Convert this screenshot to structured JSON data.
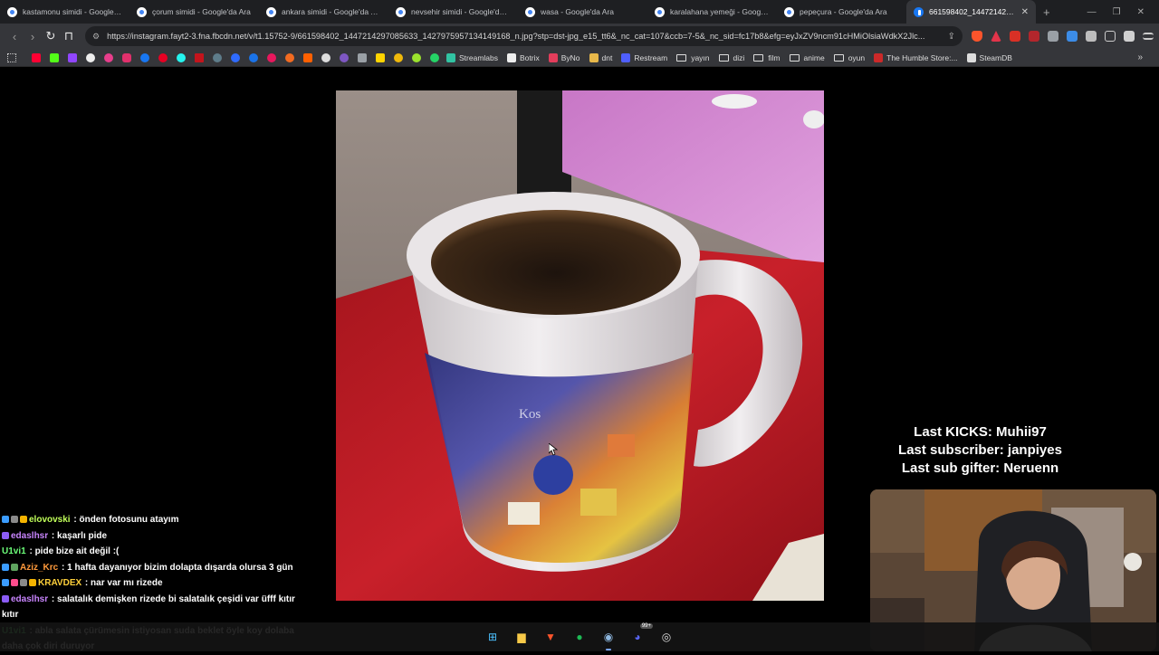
{
  "browser": {
    "tabs": [
      {
        "title": "kastamonu simidi - Google'da Ara",
        "active": false
      },
      {
        "title": "çorum simidi - Google'da Ara",
        "active": false
      },
      {
        "title": "ankara simidi - Google'da Ara",
        "active": false
      },
      {
        "title": "nevsehir simidi - Google'da Ara",
        "active": false
      },
      {
        "title": "wasa - Google'da Ara",
        "active": false
      },
      {
        "title": "karalahana yemeği - Google'da Ara",
        "active": false
      },
      {
        "title": "pepeçura - Google'da Ara",
        "active": false
      },
      {
        "title": "661598402_1447214297085...",
        "active": true
      }
    ],
    "new_tab_label": "+",
    "window_controls": {
      "minimize": "—",
      "restore": "❐",
      "close": "✕"
    },
    "url": "https://instagram.fayt2-3.fna.fbcdn.net/v/t1.15752-9/661598402_1447214297085633_1427975957134149168_n.jpg?stp=dst-jpg_e15_tt6&_nc_cat=107&ccb=7-5&_nc_sid=fc17b8&efg=eyJxZV9ncm91cHMiOlsiaWdkX2Jlc...",
    "bookmarks": [
      {
        "label": "Streamlabs",
        "color": "#31c3a2",
        "kind": "site"
      },
      {
        "label": "Botrix",
        "color": "#eeeeee",
        "kind": "site"
      },
      {
        "label": "ByNo",
        "color": "#e33d5b",
        "kind": "site"
      },
      {
        "label": "dnt",
        "color": "#e8b84a",
        "kind": "site"
      },
      {
        "label": "Restream",
        "color": "#4f5fff",
        "kind": "site"
      },
      {
        "label": "yayın",
        "kind": "folder"
      },
      {
        "label": "dizi",
        "kind": "folder"
      },
      {
        "label": "film",
        "kind": "folder"
      },
      {
        "label": "anime",
        "kind": "folder"
      },
      {
        "label": "oyun",
        "kind": "folder"
      },
      {
        "label": "The Humble Store:...",
        "color": "#cc2929",
        "kind": "site"
      },
      {
        "label": "SteamDB",
        "color": "#dddddd",
        "kind": "site"
      }
    ],
    "bookmark_more": "»"
  },
  "overlay": {
    "last_kicks": "Last KICKS: Muhii97",
    "last_subscriber": "Last subscriber: janpiyes",
    "last_sub_gifter": "Last sub gifter: Neruenn"
  },
  "photo": {
    "mug_text": "Kos"
  },
  "chat": [
    {
      "user": "elovovski",
      "color": "#c1ff5a",
      "message": " : önden fotosunu atayım",
      "badges": [
        "#3b9cff",
        "#8a8a8a",
        "#f5b400"
      ]
    },
    {
      "user": "edaslhsr",
      "color": "#c985ff",
      "message": " : kaşarlı pide",
      "badges": [
        "#8b5cf6"
      ]
    },
    {
      "user": "U1vi1",
      "color": "#6dff7a",
      "message": " : pide bize ait değil :(",
      "badges": []
    },
    {
      "user": "Aziz_Krc",
      "color": "#ff9a3c",
      "message": " : 1 hafta dayanıyor bizim dolapta dışarda olursa 3 gün",
      "badges": [
        "#3b9cff",
        "#5fa35f"
      ]
    },
    {
      "user": "KRAVDEX",
      "color": "#ffd13b",
      "message": " : nar var mı rizede",
      "badges": [
        "#3b9cff",
        "#ff4d8d",
        "#8a8a8a",
        "#f5b400"
      ]
    },
    {
      "user": "edaslhsr",
      "color": "#c985ff",
      "message": " : salatalık demişken rizede bi salatalık çeşidi var üfff kıtır kıtır",
      "badges": [
        "#8b5cf6"
      ]
    },
    {
      "user": "U1vi1",
      "color": "#6dff7a",
      "message": " : abla salata çürümesin istiyosan suda beklet öyle koy dolaba daha çok diri duruyor",
      "badges": []
    }
  ],
  "taskbar": {
    "items": [
      {
        "name": "windows-start-icon",
        "glyph": "⊞",
        "color": "#4cc2ff"
      },
      {
        "name": "file-explorer-icon",
        "glyph": "▆",
        "color": "#f7c948"
      },
      {
        "name": "brave-browser-icon",
        "glyph": "▼",
        "color": "#fb542b"
      },
      {
        "name": "spotify-icon",
        "glyph": "●",
        "color": "#1db954"
      },
      {
        "name": "steam-icon",
        "glyph": "◉",
        "color": "#8fb8e0"
      },
      {
        "name": "discord-icon",
        "glyph": "◕",
        "color": "#5865f2"
      },
      {
        "name": "obs-icon",
        "glyph": "◎",
        "color": "#dddddd"
      }
    ],
    "discord_badge": "99+"
  }
}
